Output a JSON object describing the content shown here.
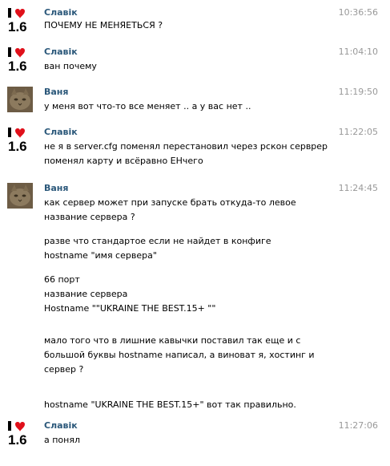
{
  "messages": [
    {
      "author": "Славік",
      "time": "10:36:56",
      "avatar": "i-love-16-logo",
      "paragraphs": [
        "ПОЧЕМУ НЕ МЕНЯЕТЬСЯ ?"
      ]
    },
    {
      "author": "Славік",
      "time": "11:04:10",
      "avatar": "i-love-16-logo",
      "paragraphs": [
        "ван почему"
      ]
    },
    {
      "author": "Ваня",
      "time": "11:19:50",
      "avatar": "cat-photo",
      "paragraphs": [
        "у меня вот что-то все меняет .. а у вас нет .."
      ]
    },
    {
      "author": "Славік",
      "time": "11:22:05",
      "avatar": "i-love-16-logo",
      "paragraphs": [
        "не я в server.cfg поменял перестановил через рскон серврер поменял карту и всёравно ЕНчего"
      ]
    },
    {
      "author": "Ваня",
      "time": "11:24:45",
      "avatar": "cat-photo",
      "paragraphs": [
        "как сервер может при запуске брать откуда-то левое название сервера ?",
        "разве что стандартое если не найдет в конфиге\nhostname \"имя сервера\"",
        "66 порт\nназвание сервера\nHostname \"\"UKRAINE THE BEST.15+ \"\"",
        "мало того что в лишние кавычки поставил так еще и с большой буквы hostname написал, а виноват я, хостинг и сервер ?",
        "hostname \"UKRAINE THE BEST.15+\" вот так правильно."
      ]
    },
    {
      "author": "Славік",
      "time": "11:27:06",
      "avatar": "i-love-16-logo",
      "paragraphs": [
        "а понял"
      ]
    }
  ],
  "logo_text": {
    "i": "I",
    "num": "1.6"
  },
  "colors": {
    "name": "#2b587a",
    "time": "#999999",
    "heart": "#e0101a"
  }
}
